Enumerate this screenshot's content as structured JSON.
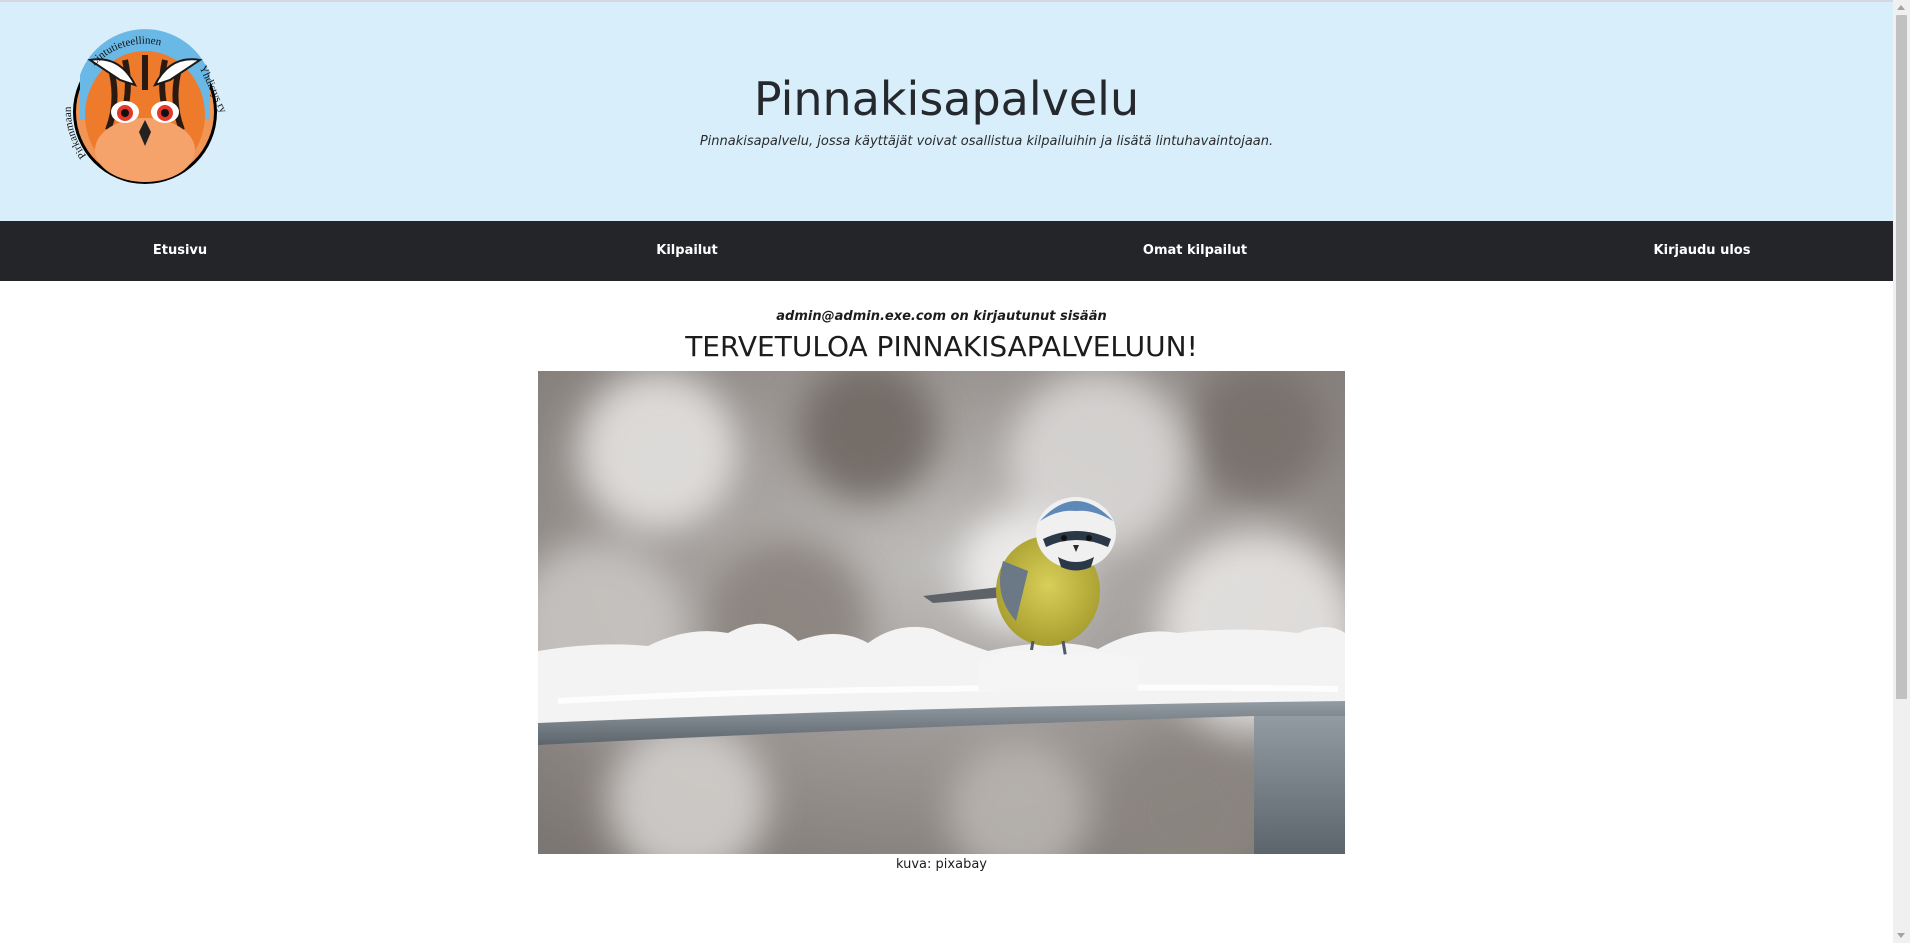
{
  "header": {
    "title": "Pinnakisapalvelu",
    "subtitle": "Pinnakisapalvelu, jossa käyttäjät voivat osallistua kilpailuihin ja lisätä lintuhavaintojaan.",
    "logo_text_top": "Lintutieteellinen",
    "logo_text_left": "Pirkanmaan",
    "logo_text_right": "Yhdistys ry"
  },
  "nav": {
    "items": [
      {
        "label": "Etusivu"
      },
      {
        "label": "Kilpailut"
      },
      {
        "label": "Omat kilpailut"
      },
      {
        "label": "Kirjaudu ulos"
      }
    ]
  },
  "main": {
    "login_status": "admin@admin.exe.com on kirjautunut sisään",
    "welcome": "TERVETULOA PINNAKISAPALVELUUN!",
    "image_credit": "kuva: pixabay"
  },
  "colors": {
    "header_bg": "#d8eefb",
    "nav_bg": "#242528",
    "logo_orange": "#ee7a2c"
  }
}
